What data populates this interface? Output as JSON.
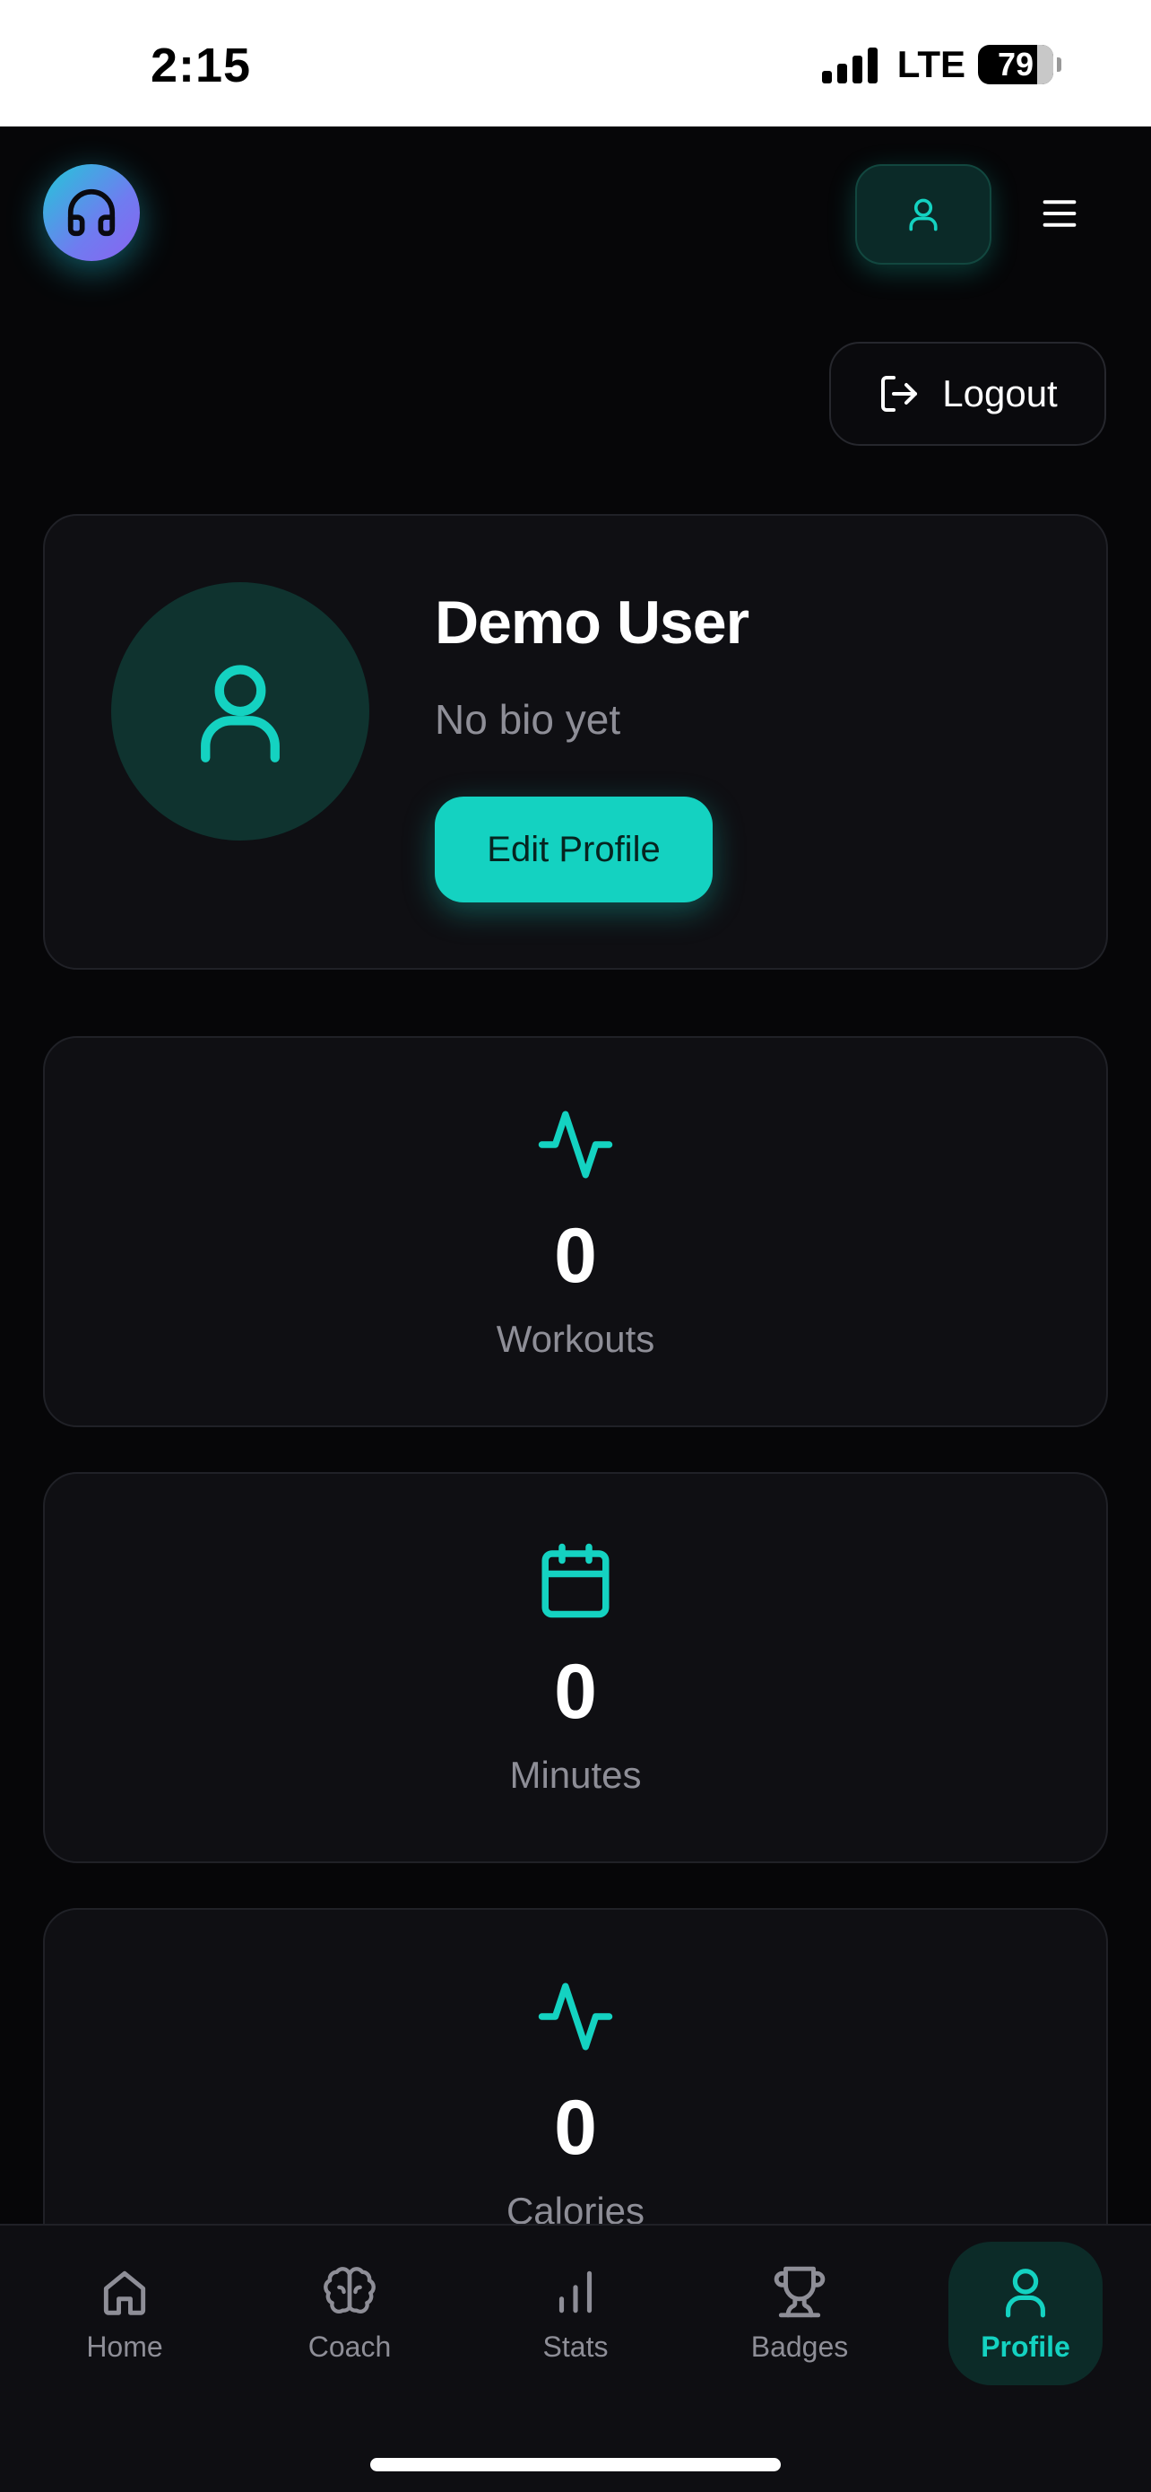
{
  "status_bar": {
    "time": "2:15",
    "network": "LTE",
    "battery": "79",
    "battery_level": 0.79
  },
  "header": {
    "logo_icon": "headphones-icon",
    "profile_icon": "user-icon",
    "menu_icon": "hamburger-menu-icon",
    "logout_label": "Logout",
    "logout_icon": "logout-icon"
  },
  "profile": {
    "name": "Demo User",
    "bio": "No bio yet",
    "edit_label": "Edit Profile",
    "avatar_icon": "user-icon"
  },
  "stats": [
    {
      "icon": "activity-icon",
      "value": "0",
      "label": "Workouts"
    },
    {
      "icon": "calendar-icon",
      "value": "0",
      "label": "Minutes"
    },
    {
      "icon": "activity-icon",
      "value": "0",
      "label": "Calories"
    }
  ],
  "bottom_nav": {
    "items": [
      {
        "label": "Home",
        "icon": "home-icon",
        "active": false
      },
      {
        "label": "Coach",
        "icon": "brain-icon",
        "active": false
      },
      {
        "label": "Stats",
        "icon": "bar-chart-icon",
        "active": false
      },
      {
        "label": "Badges",
        "icon": "trophy-icon",
        "active": false
      },
      {
        "label": "Profile",
        "icon": "user-icon",
        "active": true
      }
    ]
  },
  "colors": {
    "accent": "#14d2c1",
    "background": "#060608",
    "card": "#0f0f13",
    "muted_text": "#8e8e97"
  }
}
